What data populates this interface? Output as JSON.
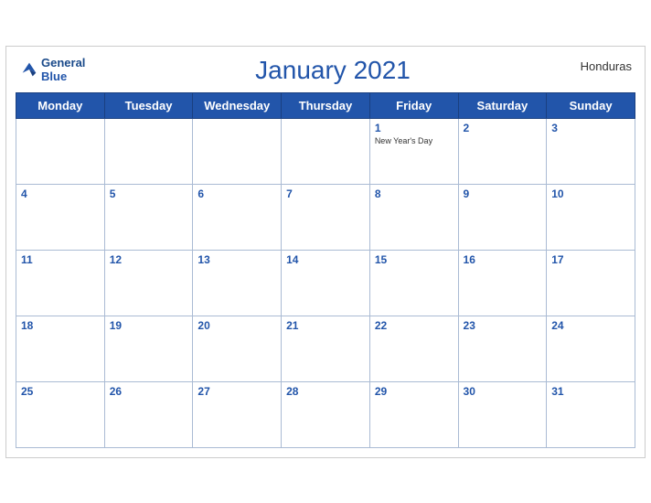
{
  "header": {
    "logo_line1": "General",
    "logo_line2": "Blue",
    "title": "January 2021",
    "country": "Honduras"
  },
  "days_of_week": [
    "Monday",
    "Tuesday",
    "Wednesday",
    "Thursday",
    "Friday",
    "Saturday",
    "Sunday"
  ],
  "weeks": [
    [
      {
        "day": "",
        "holiday": ""
      },
      {
        "day": "",
        "holiday": ""
      },
      {
        "day": "",
        "holiday": ""
      },
      {
        "day": "",
        "holiday": ""
      },
      {
        "day": "1",
        "holiday": "New Year's Day"
      },
      {
        "day": "2",
        "holiday": ""
      },
      {
        "day": "3",
        "holiday": ""
      }
    ],
    [
      {
        "day": "4",
        "holiday": ""
      },
      {
        "day": "5",
        "holiday": ""
      },
      {
        "day": "6",
        "holiday": ""
      },
      {
        "day": "7",
        "holiday": ""
      },
      {
        "day": "8",
        "holiday": ""
      },
      {
        "day": "9",
        "holiday": ""
      },
      {
        "day": "10",
        "holiday": ""
      }
    ],
    [
      {
        "day": "11",
        "holiday": ""
      },
      {
        "day": "12",
        "holiday": ""
      },
      {
        "day": "13",
        "holiday": ""
      },
      {
        "day": "14",
        "holiday": ""
      },
      {
        "day": "15",
        "holiday": ""
      },
      {
        "day": "16",
        "holiday": ""
      },
      {
        "day": "17",
        "holiday": ""
      }
    ],
    [
      {
        "day": "18",
        "holiday": ""
      },
      {
        "day": "19",
        "holiday": ""
      },
      {
        "day": "20",
        "holiday": ""
      },
      {
        "day": "21",
        "holiday": ""
      },
      {
        "day": "22",
        "holiday": ""
      },
      {
        "day": "23",
        "holiday": ""
      },
      {
        "day": "24",
        "holiday": ""
      }
    ],
    [
      {
        "day": "25",
        "holiday": ""
      },
      {
        "day": "26",
        "holiday": ""
      },
      {
        "day": "27",
        "holiday": ""
      },
      {
        "day": "28",
        "holiday": ""
      },
      {
        "day": "29",
        "holiday": ""
      },
      {
        "day": "30",
        "holiday": ""
      },
      {
        "day": "31",
        "holiday": ""
      }
    ]
  ]
}
